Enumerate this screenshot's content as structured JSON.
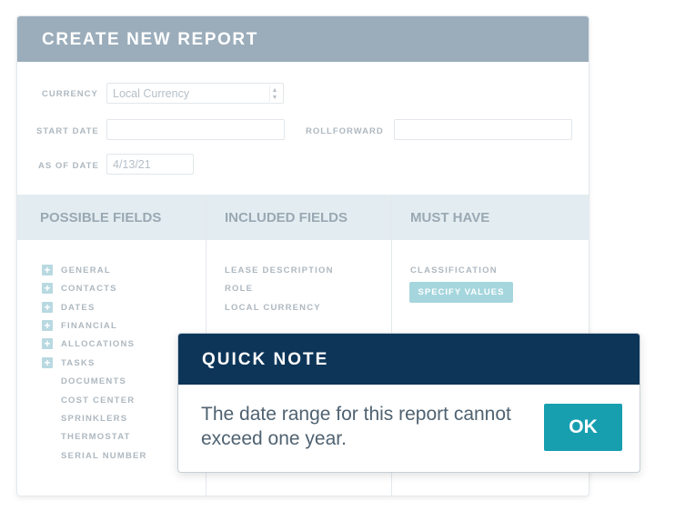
{
  "card": {
    "title": "CREATE NEW REPORT"
  },
  "form": {
    "currency_label": "CURRENCY",
    "currency_value": "Local Currency",
    "start_date_label": "START DATE",
    "start_date_value": "",
    "rollforward_label": "ROLLFORWARD",
    "rollforward_value": "",
    "as_of_date_label": "AS OF DATE",
    "as_of_date_value": "4/13/21"
  },
  "columns": {
    "possible_title": "POSSIBLE FIELDS",
    "included_title": "INCLUDED FIELDS",
    "must_have_title": "MUST HAVE"
  },
  "possible_fields": [
    {
      "label": "GENERAL",
      "expandable": true
    },
    {
      "label": "CONTACTS",
      "expandable": true
    },
    {
      "label": "DATES",
      "expandable": true
    },
    {
      "label": "FINANCIAL",
      "expandable": true
    },
    {
      "label": "ALLOCATIONS",
      "expandable": true
    },
    {
      "label": "TASKS",
      "expandable": true
    },
    {
      "label": "DOCUMENTS",
      "expandable": false
    },
    {
      "label": "COST CENTER",
      "expandable": false
    },
    {
      "label": "SPRINKLERS",
      "expandable": false
    },
    {
      "label": "THERMOSTAT",
      "expandable": false
    },
    {
      "label": "SERIAL NUMBER",
      "expandable": false
    }
  ],
  "included_fields": [
    "LEASE DESCRIPTION",
    "ROLE",
    "LOCAL CURRENCY"
  ],
  "must_have": {
    "items": [
      "CLASSIFICATION"
    ],
    "specify_button": "SPECIFY VALUES"
  },
  "modal": {
    "title": "QUICK NOTE",
    "message": "The date range for this report cannot exceed one year.",
    "ok_label": "OK"
  },
  "icons": {
    "plus": "plus-icon",
    "select_arrows": "updown-arrows-icon"
  },
  "colors": {
    "header_bg": "#9badbb",
    "columns_bg": "#e3edf1",
    "modal_header_bg": "#0c3558",
    "ok_button_bg": "#179fb0",
    "specify_button_bg": "#a6d6dd"
  }
}
